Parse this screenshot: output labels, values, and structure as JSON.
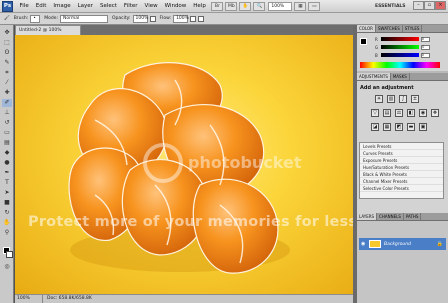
{
  "app": {
    "logo": "Ps"
  },
  "menubar": {
    "items": [
      "File",
      "Edit",
      "Image",
      "Layer",
      "Select",
      "Filter",
      "View",
      "Window",
      "Help"
    ],
    "zoom": "100%",
    "workspace": "ESSENTIALS"
  },
  "options": {
    "brush_label": "Brush:",
    "mode_label": "Mode:",
    "mode_value": "Normal",
    "opacity_label": "Opacity:",
    "opacity_value": "100%",
    "flow_label": "Flow:",
    "flow_value": "100%"
  },
  "document": {
    "tab_title": "Untitled-2 @ 100% (RGB/8)",
    "status_zoom": "100%",
    "status_doc": "Doc: 658.8K/658.8K"
  },
  "panels": {
    "color_tabs": [
      "COLOR",
      "SWATCHES",
      "STYLES"
    ],
    "color_sliders": [
      {
        "label": "R",
        "value": "0"
      },
      {
        "label": "G",
        "value": "0"
      },
      {
        "label": "B",
        "value": "0"
      }
    ],
    "adj_tabs": [
      "ADJUSTMENTS",
      "MASKS"
    ],
    "adj_title": "Add an adjustment",
    "presets": [
      "Levels Presets",
      "Curves Presets",
      "Exposure Presets",
      "Hue/Saturation Presets",
      "Black & White Presets",
      "Channel Mixer Presets",
      "Selective Color Presets"
    ],
    "layer_tabs": [
      "LAYERS",
      "CHANNELS",
      "PATHS"
    ],
    "layer_name": "Background"
  },
  "watermark": {
    "text": "Protect more of your memories for less!",
    "logo_text": "photobucket"
  },
  "colors": {
    "accent": "#4a7ec7",
    "canvas_bg": "#fbd53a",
    "orange": "#f38a1a"
  }
}
